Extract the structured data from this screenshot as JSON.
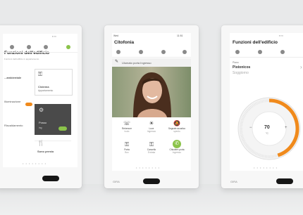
{
  "left_panel": {
    "title": "Funzioni dell'edificio",
    "subtitle": "Funzioni dell'edificio in appartamento",
    "tile_labels": [
      "Cistema",
      "Appartamento",
      "Posso",
      "ing",
      "Sono presto"
    ],
    "side_labels": [
      "...ambientale",
      "Illuminazione",
      "Riscaldamento"
    ]
  },
  "center_panel": {
    "status_left": "Wed",
    "status_right": "11:51",
    "title": "Citofonia",
    "banner_label": "Ulumato porta Ingresso",
    "actions": [
      {
        "icon": "handset-icon",
        "label": "Rebenure",
        "sub": "Icuto"
      },
      {
        "icon": "bulb-icon",
        "label": "Luce",
        "sub": "Ingresso"
      },
      {
        "icon": "mute-icon",
        "label": "Segnale acustico",
        "sub": "spento"
      },
      {
        "icon": "key-icon",
        "label": "Porta",
        "sub": "Box"
      },
      {
        "icon": "key-icon",
        "label": "Cancello",
        "sub": "Entrata"
      },
      {
        "icon": "phone-icon",
        "label": "Chiudere porta",
        "sub": "ingresso"
      }
    ],
    "brand": "GIRA"
  },
  "right_panel": {
    "title": "Funzioni dell'edificio",
    "room_label": "Piano",
    "room_name": "Pistonicos",
    "room_sub": "Soggiorno",
    "temperature": "70",
    "temperature_unit": "°C",
    "minus": "−",
    "plus": "+",
    "dial_fraction": 0.45,
    "brand": "GIRA"
  },
  "colors": {
    "accent_orange": "#f08a1c",
    "accent_green": "#8bc34a",
    "dark_tile": "#4a4a4a"
  }
}
